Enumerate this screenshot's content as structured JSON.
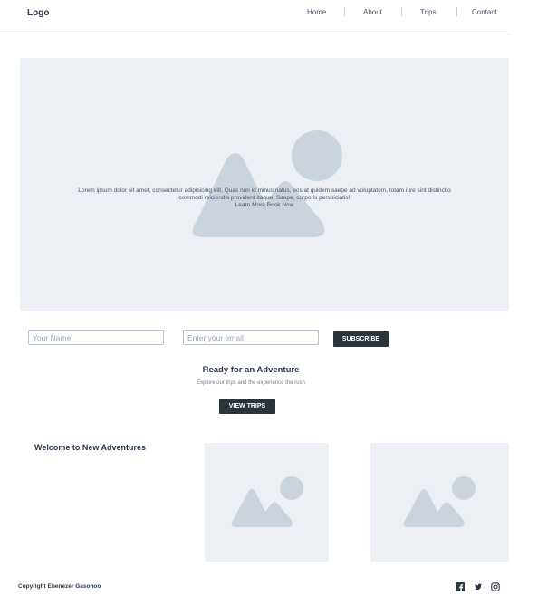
{
  "nav": {
    "logo": "Logo",
    "links": [
      "Home",
      "About",
      "Trips",
      "Contact"
    ]
  },
  "hero": {
    "image_icon": "image-placeholder-icon",
    "text": "Lorem ipsum dolor sit amet, consectetur adipisicing elit. Quas non id minus natus, eos at quidem saepe ad voluptatem, totam iure sint distinctio commodi reiciendis provident itaque. Saepe, corporis perspiciatis!",
    "learn_more": "Learn More",
    "book_now": "Book Now"
  },
  "subscribe": {
    "name_placeholder": "Your Name",
    "email_placeholder": "Enter your email",
    "button": "SUBSCRIBE"
  },
  "cta": {
    "title": "Ready for an Adventure",
    "subtitle": "Explore our trips and the experience the rush",
    "button": "VIEW TRIPS"
  },
  "welcome": {
    "title": "Welcome to New Adventures"
  },
  "footer": {
    "copyright": "Copyright Ebenezer Gasonoo",
    "social": [
      "facebook-icon",
      "twitter-icon",
      "instagram-icon"
    ]
  },
  "colors": {
    "placeholder_bg": "#eceff4",
    "placeholder_shape": "#cbd3dd",
    "button_bg": "#2d333b"
  }
}
